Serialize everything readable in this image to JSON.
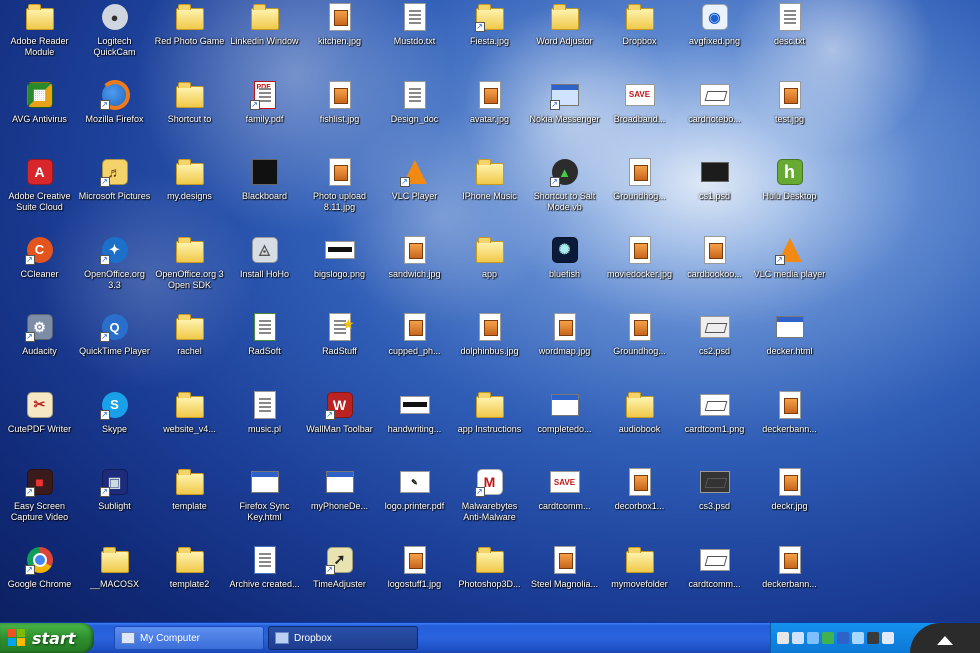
{
  "desktop": {
    "icons": [
      {
        "label": "Adobe Reader Module",
        "type": "folder"
      },
      {
        "label": "AVG Antivirus",
        "type": "app-multi"
      },
      {
        "label": "Adobe Creative Suite Cloud",
        "type": "app-red"
      },
      {
        "label": "CCleaner",
        "type": "app-cc"
      },
      {
        "label": "Audacity",
        "type": "app-grey"
      },
      {
        "label": "CutePDF Writer",
        "type": "app-cut"
      },
      {
        "label": "Easy Screen Capture Video",
        "type": "app-dark"
      },
      {
        "label": "Google Chrome",
        "type": "chrome"
      },
      {
        "label": "Logitech QuickCam",
        "type": "app-cam"
      },
      {
        "label": "Mozilla Firefox",
        "type": "firefox"
      },
      {
        "label": "Microsoft Pictures",
        "type": "app-pics"
      },
      {
        "label": "OpenOffice.org 3.3",
        "type": "app-oo"
      },
      {
        "label": "QuickTime Player",
        "type": "app-qt"
      },
      {
        "label": "Skype",
        "type": "skype"
      },
      {
        "label": "Sublight",
        "type": "app-sub"
      },
      {
        "label": "__MACOSX",
        "type": "folder"
      },
      {
        "label": "Red Photo Game",
        "type": "folder"
      },
      {
        "label": "Shortcut to",
        "type": "folder"
      },
      {
        "label": "my.designs",
        "type": "folder"
      },
      {
        "label": "OpenOffice.org 3 Open SDK",
        "type": "folder"
      },
      {
        "label": "rachel",
        "type": "folder"
      },
      {
        "label": "website_v4...",
        "type": "folder"
      },
      {
        "label": "template",
        "type": "folder"
      },
      {
        "label": "template2",
        "type": "folder"
      },
      {
        "label": "Linkedin Window",
        "type": "folder"
      },
      {
        "label": "family.pdf",
        "type": "app-pdfred"
      },
      {
        "label": "Blackboard",
        "type": "dark"
      },
      {
        "label": "Install HoHo",
        "type": "app-install"
      },
      {
        "label": "RadSoft",
        "type": "doc-green"
      },
      {
        "label": "music.pl",
        "type": "doc"
      },
      {
        "label": "Firefox Sync Key.html",
        "type": "html"
      },
      {
        "label": "Archive created...",
        "type": "doc-arch"
      },
      {
        "label": "kitchen.jpg",
        "type": "jpg"
      },
      {
        "label": "fishlist.jpg",
        "type": "jpg"
      },
      {
        "label": "Photo upload 8.11.jpg",
        "type": "jpg"
      },
      {
        "label": "bigslogo.png",
        "type": "blackbar"
      },
      {
        "label": "RadStuff",
        "type": "doc-star"
      },
      {
        "label": "WallMan Toolbar",
        "type": "app-wall"
      },
      {
        "label": "myPhoneDe...",
        "type": "html"
      },
      {
        "label": "TimeAdjuster",
        "type": "app-time"
      },
      {
        "label": "Mustdo.txt",
        "type": "doc"
      },
      {
        "label": "Design_doc",
        "type": "doc"
      },
      {
        "label": "VLC Player",
        "type": "vlc"
      },
      {
        "label": "sandwich.jpg",
        "type": "jpg"
      },
      {
        "label": "cupped_ph...",
        "type": "jpg"
      },
      {
        "label": "handwriting...",
        "type": "blackbar"
      },
      {
        "label": "logo.printer.pdf",
        "type": "card-pen"
      },
      {
        "label": "logostuff1.jpg",
        "type": "jpg"
      },
      {
        "label": "Fiesta.jpg",
        "type": "folder-shot"
      },
      {
        "label": "avatar.jpg",
        "type": "jpg"
      },
      {
        "label": "IPhone Music",
        "type": "folder"
      },
      {
        "label": "app",
        "type": "folder"
      },
      {
        "label": "dolphinbus.jpg",
        "type": "jpg"
      },
      {
        "label": "app Instructions",
        "type": "folder"
      },
      {
        "label": "Malwarebytes Anti-Malware",
        "type": "app-mb"
      },
      {
        "label": "Photoshop3D...",
        "type": "folder"
      },
      {
        "label": "Word Adjustor",
        "type": "folder"
      },
      {
        "label": "Nokia Messenger",
        "type": "app-nokia"
      },
      {
        "label": "Shortcut to Salt Mode.vb",
        "type": "app-green"
      },
      {
        "label": "bluefish",
        "type": "app-fan"
      },
      {
        "label": "wordmap.jpg",
        "type": "jpg"
      },
      {
        "label": "completedo...",
        "type": "html"
      },
      {
        "label": "cardtcomm...",
        "type": "card"
      },
      {
        "label": "Steel Magnolia...",
        "type": "doc-jpg"
      },
      {
        "label": "Dropbox",
        "type": "folder"
      },
      {
        "label": "Broadband...",
        "type": "card"
      },
      {
        "label": "Groundhog...",
        "type": "jpg"
      },
      {
        "label": "moviedocker.jpg",
        "type": "jpg"
      },
      {
        "label": "Groundhog...",
        "type": "jpg"
      },
      {
        "label": "audiobook",
        "type": "folder"
      },
      {
        "label": "decorbox1...",
        "type": "jpg"
      },
      {
        "label": "mymovefolder",
        "type": "folder"
      },
      {
        "label": "avgfixed.png",
        "type": "app-pic"
      },
      {
        "label": "cardnotebo...",
        "type": "mini"
      },
      {
        "label": "cs1.psd",
        "type": "pdfblack"
      },
      {
        "label": "cardbookoo...",
        "type": "jpg"
      },
      {
        "label": "cs2.psd",
        "type": "mini-car"
      },
      {
        "label": "cardtcom1.png",
        "type": "mini"
      },
      {
        "label": "cs3.psd",
        "type": "mini-dark"
      },
      {
        "label": "cardtcomm...",
        "type": "mini"
      },
      {
        "label": "desc.txt",
        "type": "doc"
      },
      {
        "label": "test.jpg",
        "type": "jpg"
      },
      {
        "label": "Hulu Desktop",
        "type": "hulu"
      },
      {
        "label": "VLC media player",
        "type": "vlc"
      },
      {
        "label": "decker.html",
        "type": "html"
      },
      {
        "label": "deckerbann...",
        "type": "jpg"
      },
      {
        "label": "deckr.jpg",
        "type": "jpg"
      },
      {
        "label": "deckerbann...",
        "type": "jpg"
      }
    ]
  },
  "taskbar": {
    "start_label": "start",
    "tasks": [
      {
        "label": "My Computer",
        "state": "inactive"
      },
      {
        "label": "Dropbox",
        "state": "active"
      }
    ],
    "tray_icons": [
      "help-icon",
      "network-icon",
      "volume-icon",
      "security-icon",
      "bluetooth-icon",
      "sync-icon",
      "update-icon",
      "wifi-icon"
    ]
  },
  "colors": {
    "taskbar_blue": "#245edb",
    "start_green": "#2e8f2e",
    "tray_blue": "#0c78d6",
    "folder_yellow": "#f0c94a"
  }
}
